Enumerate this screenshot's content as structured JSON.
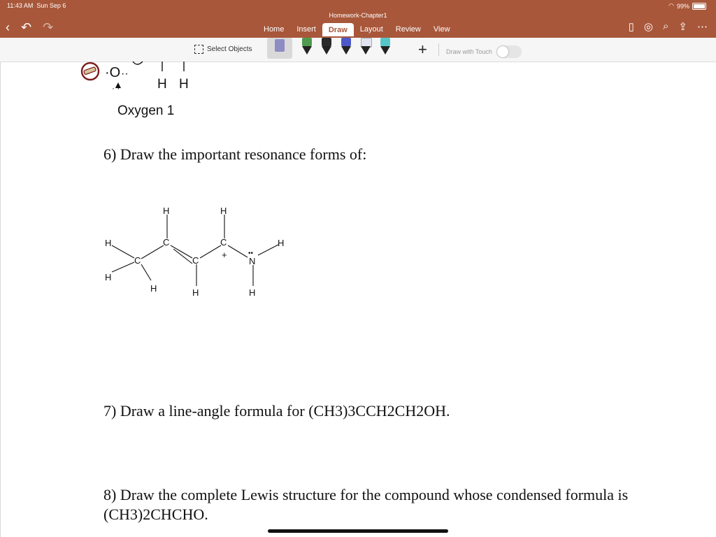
{
  "status": {
    "time": "11:43 AM",
    "date": "Sun Sep 6",
    "battery": "99%"
  },
  "document": {
    "title": "Homework-Chapter1"
  },
  "tabs": [
    "Home",
    "Insert",
    "Draw",
    "Layout",
    "Review",
    "View"
  ],
  "active_tab": "Draw",
  "toolbar": {
    "select_objects": "Select Objects",
    "draw_with_touch": "Draw with Touch"
  },
  "pen_colors": [
    "#4e9a4e",
    "#2a2a2a",
    "#4c58c9",
    "#dfe4ef",
    "#56c7c9"
  ],
  "accent_color": "#a8573a",
  "content": {
    "oxygen_label": "Oxygen 1",
    "q6": "6) Draw the important resonance forms of:",
    "q7": "7) Draw a line-angle formula for (CH3)3CCH2CH2OH.",
    "q8_line1": "8) Draw the complete Lewis structure for the compound whose condensed formula is",
    "q8_line2": "(CH3)2CHCHO."
  },
  "molecule": {
    "atoms": {
      "H": "H",
      "C": "C",
      "N": "N",
      "plus": "+",
      "lone_pair": "••"
    }
  }
}
